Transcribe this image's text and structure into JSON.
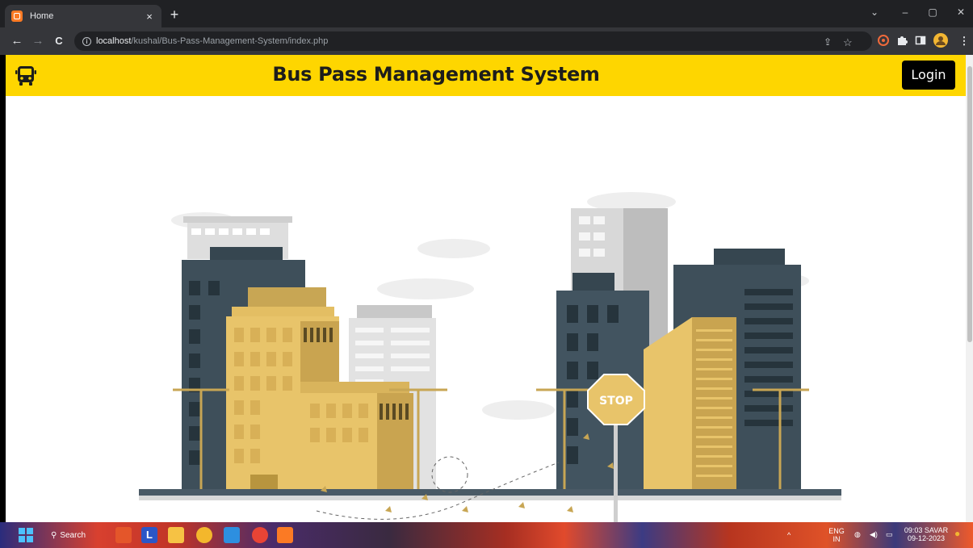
{
  "browser": {
    "tab": {
      "title": "Home",
      "close_glyph": "×"
    },
    "new_tab_glyph": "+",
    "window_controls": {
      "tab_search": "⌄",
      "minimize": "–",
      "restore": "▢",
      "close": "✕"
    },
    "nav": {
      "back": "←",
      "forward": "→",
      "reload": "C"
    },
    "address": {
      "host": "localhost",
      "path": "/kushal/Bus-Pass-Management-System/index.php"
    },
    "omnibox_icons": [
      "share-icon",
      "star-icon"
    ],
    "extension_icons": [
      "extension-orange-icon",
      "puzzle-icon",
      "side-panel-icon",
      "profile-avatar-icon",
      "menu-icon"
    ]
  },
  "site": {
    "title": "Bus Pass Management System",
    "login_label": "Login",
    "logo_icon": "bus-icon",
    "accent_color": "#fed600",
    "hero": {
      "sign_text": "STOP"
    }
  },
  "taskbar": {
    "search_label": "Search",
    "apps": [
      "start-icon",
      "search-icon",
      "game-app-icon",
      "l-app-icon",
      "file-explorer-icon",
      "chrome-dev-icon",
      "vscode-icon",
      "chrome-icon",
      "xampp-icon"
    ],
    "tray": {
      "lang_top": "ENG",
      "lang_bottom": "IN",
      "time": "09:03 SAVAR",
      "date": "09-12-2023"
    }
  }
}
